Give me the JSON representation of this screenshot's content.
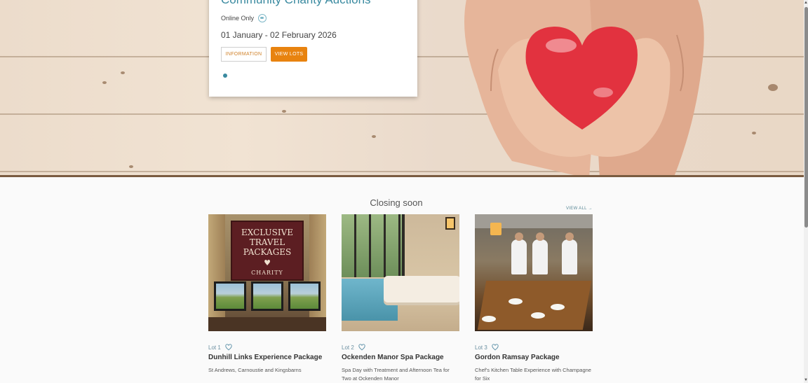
{
  "hero": {
    "card": {
      "title": "Community Charity Auctions",
      "availability": "Online Only",
      "dates": "01 January - 02 February 2026",
      "info_button": "INFORMATION",
      "lots_button": "VIEW LOTS"
    }
  },
  "closing_soon": {
    "heading": "Closing soon",
    "view_all": "VIEW ALL →",
    "lots": [
      {
        "lot_label": "Lot 1",
        "name": "Dunhill Links Experience Package",
        "description": "St Andrews, Carnoustie and Kingsbarns",
        "image_text": {
          "line1": "EXCLUSIVE",
          "line2": "TRAVEL",
          "line3": "PACKAGES",
          "heart": "♥",
          "line4": "CHARITY"
        }
      },
      {
        "lot_label": "Lot 2",
        "name": "Ockenden Manor Spa Package",
        "description": "Spa Day with Treatment and Afternoon Tea for Two at Ockenden Manor"
      },
      {
        "lot_label": "Lot 3",
        "name": "Gordon Ramsay Package",
        "description": "Chef's Kitchen Table Experience with Champagne for Six"
      }
    ]
  },
  "colors": {
    "accent_teal": "#3a8aa0",
    "button_orange": "#e8830f",
    "heart_red": "#e2323f"
  },
  "icons": [
    "globe-icon",
    "heart-outline-icon",
    "arrow-right-icon",
    "scroll-up-icon",
    "scroll-down-icon"
  ]
}
